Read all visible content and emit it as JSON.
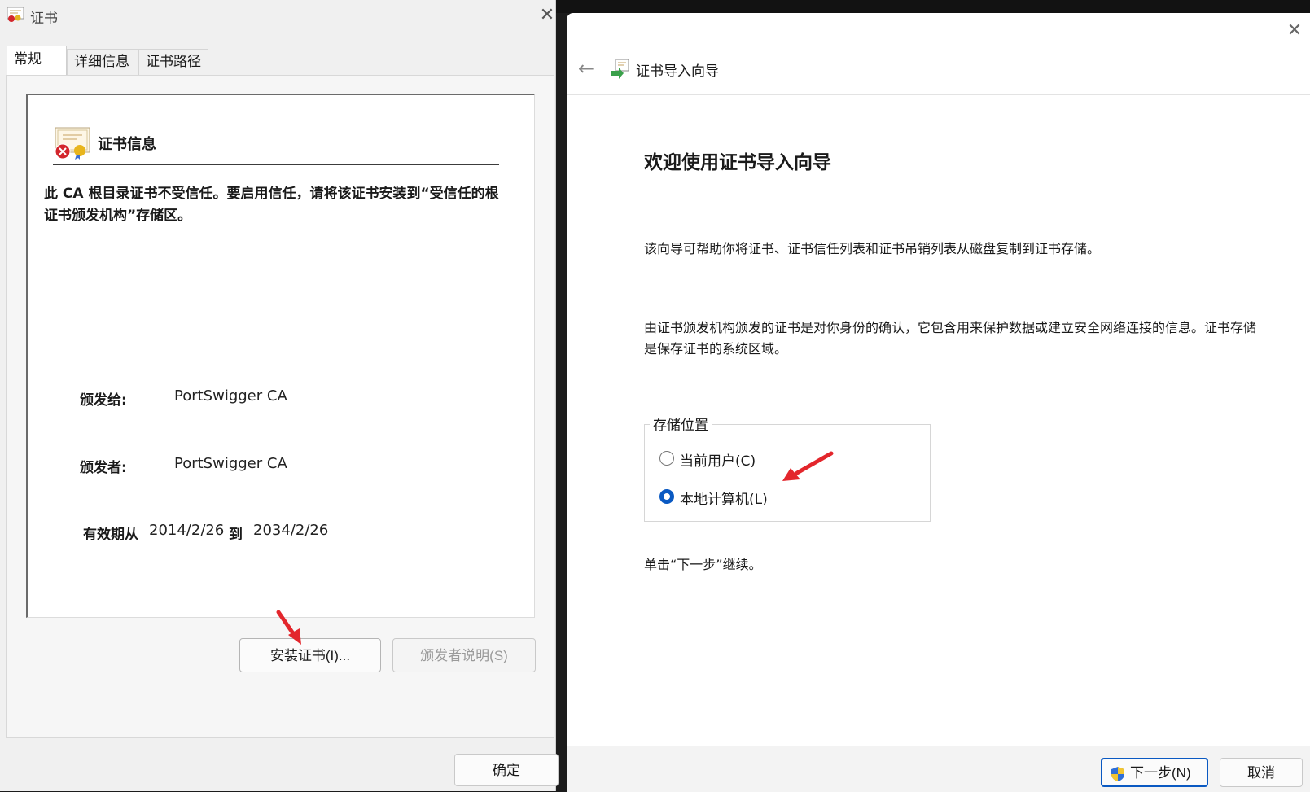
{
  "cert_dialog": {
    "title": "证书",
    "close": "✕",
    "tabs": [
      {
        "label": "常规"
      },
      {
        "label": "详细信息"
      },
      {
        "label": "证书路径"
      }
    ],
    "info_title": "证书信息",
    "warning": "此 CA 根目录证书不受信任。要启用信任，请将该证书安装到“受信任的根证书颁发机构”存储区。",
    "issued_to_label": "颁发给:",
    "issued_to_value": "PortSwigger CA",
    "issued_by_label": "颁发者:",
    "issued_by_value": "PortSwigger CA",
    "valid_from_label": "有效期从",
    "valid_from": "2014/2/26",
    "valid_to_label": "到",
    "valid_to": "2034/2/26",
    "install_button": "安装证书(I)...",
    "issuer_statement_button": "颁发者说明(S)",
    "ok_button": "确定"
  },
  "wizard": {
    "close": "✕",
    "back": "←",
    "title": "证书导入向导",
    "heading": "欢迎使用证书导入向导",
    "paragraph1": "该向导可帮助你将证书、证书信任列表和证书吊销列表从磁盘复制到证书存储。",
    "paragraph2": "由证书颁发机构颁发的证书是对你身份的确认，它包含用来保护数据或建立安全网络连接的信息。证书存储是保存证书的系统区域。",
    "store_location": {
      "legend": "存储位置",
      "options": [
        {
          "label": "当前用户(C)",
          "checked": false
        },
        {
          "label": "本地计算机(L)",
          "checked": true
        }
      ]
    },
    "continue_hint": "单击“下一步”继续。",
    "next_button": "下一步(N)",
    "cancel_button": "取消"
  },
  "colors": {
    "accent": "#0a59c2",
    "annotation_arrow": "#e3262c"
  }
}
